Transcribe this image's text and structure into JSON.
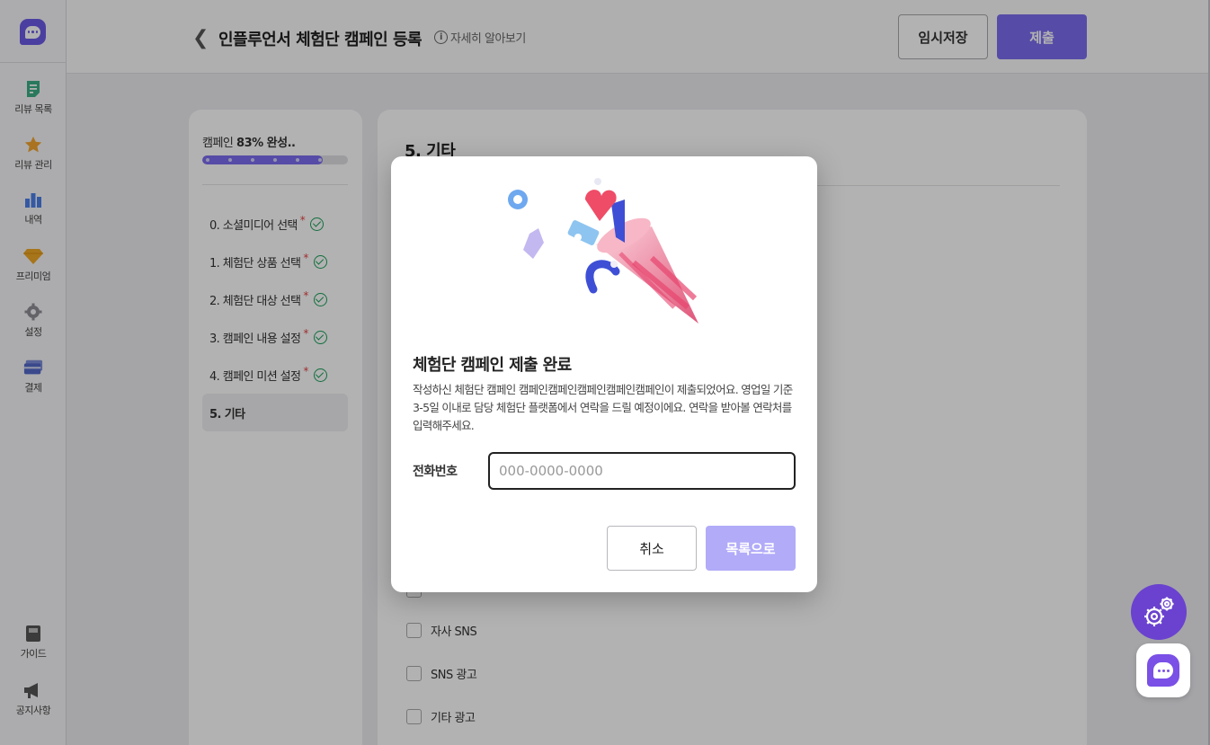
{
  "sidebar": {
    "items": [
      {
        "label": "리뷰 목록",
        "icon": "document-icon"
      },
      {
        "label": "리뷰 관리",
        "icon": "star-icon"
      },
      {
        "label": "내역",
        "icon": "bar-chart-icon"
      },
      {
        "label": "프리미엄",
        "icon": "diamond-icon"
      },
      {
        "label": "설정",
        "icon": "gear-icon"
      },
      {
        "label": "결제",
        "icon": "card-icon"
      },
      {
        "label": "가이드",
        "icon": "book-icon"
      },
      {
        "label": "공지사항",
        "icon": "megaphone-icon"
      }
    ]
  },
  "header": {
    "title": "인플루언서 체험단 캠페인 등록",
    "info_label": "자세히 알아보기",
    "draft_label": "임시저장",
    "submit_label": "제출"
  },
  "progress": {
    "prefix": "캠페인",
    "value_text": "83% 완성..",
    "fraction": 0.83
  },
  "steps": [
    {
      "label": "0. 소셜미디어 선택",
      "required": true,
      "done": true
    },
    {
      "label": "1. 체험단 상품 선택",
      "required": true,
      "done": true
    },
    {
      "label": "2. 체험단 대상 선택",
      "required": true,
      "done": true
    },
    {
      "label": "3. 캠페인 내용 설정",
      "required": true,
      "done": true
    },
    {
      "label": "4. 캠페인 미션 설정",
      "required": true,
      "done": true
    },
    {
      "label": "5. 기타",
      "required": false,
      "done": false,
      "active": true
    }
  ],
  "content": {
    "title": "5. 기타",
    "options": [
      "자사 SNS",
      "SNS 광고",
      "기타 광고"
    ]
  },
  "modal": {
    "title": "체험단 캠페인 제출 완료",
    "description": "작성하신 체험단 캠페인 캠페인캠페인캠페인캠페인캠페인이 제출되었어요. 영업일 기준 3-5일 이내로 담당 체험단 플랫폼에서 연락을 드릴 예정이에요. 연락을 받아볼 연락처를 입력해주세요.",
    "phone_label": "전화번호",
    "phone_placeholder": "000-0000-0000",
    "phone_value": "",
    "cancel_label": "취소",
    "list_label": "목록으로"
  },
  "colors": {
    "accent": "#7b6ef0",
    "accent_disabled": "#b1abf8",
    "success": "#1aa05a",
    "required": "#e64545"
  }
}
